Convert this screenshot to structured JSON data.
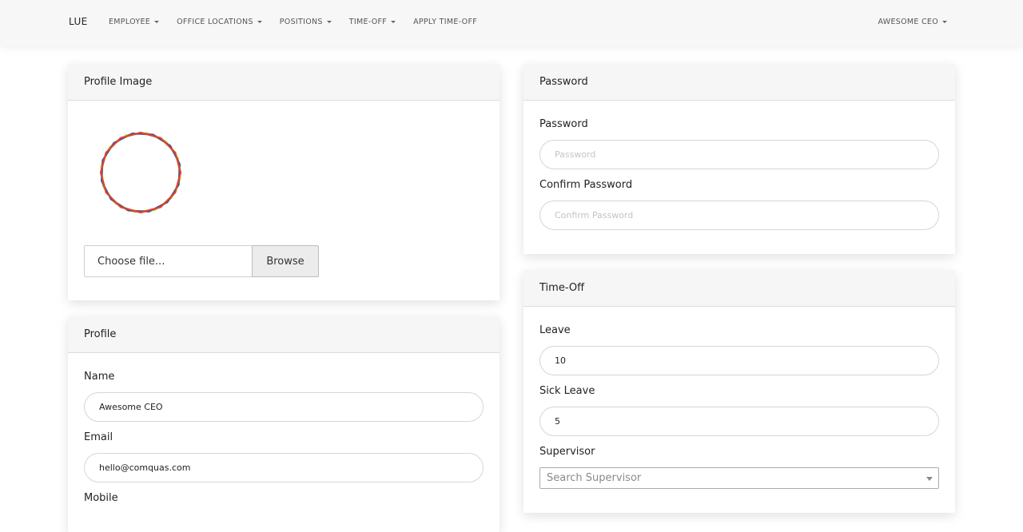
{
  "nav": {
    "brand": "LUE",
    "items": [
      {
        "label": "EMPLOYEE",
        "dropdown": true
      },
      {
        "label": "OFFICE LOCATIONS",
        "dropdown": true
      },
      {
        "label": "POSITIONS",
        "dropdown": true
      },
      {
        "label": "TIME-OFF",
        "dropdown": true
      },
      {
        "label": "APPLY TIME-OFF",
        "dropdown": false
      }
    ],
    "user": "AWESOME CEO"
  },
  "profile_image": {
    "title": "Profile Image",
    "file_placeholder": "Choose file...",
    "browse_label": "Browse"
  },
  "password": {
    "title": "Password",
    "password_label": "Password",
    "password_placeholder": "Password",
    "confirm_label": "Confirm Password",
    "confirm_placeholder": "Confirm Password"
  },
  "profile": {
    "title": "Profile",
    "name_label": "Name",
    "name_value": "Awesome CEO",
    "email_label": "Email",
    "email_value": "hello@comquas.com",
    "mobile_label": "Mobile"
  },
  "timeoff": {
    "title": "Time-Off",
    "leave_label": "Leave",
    "leave_value": "10",
    "sick_label": "Sick Leave",
    "sick_value": "5",
    "supervisor_label": "Supervisor",
    "supervisor_placeholder": "Search Supervisor"
  },
  "colors": {
    "logo_green": "#b5cf3a",
    "logo_blue": "#2f5d9e",
    "logo_red": "#e2412c"
  }
}
